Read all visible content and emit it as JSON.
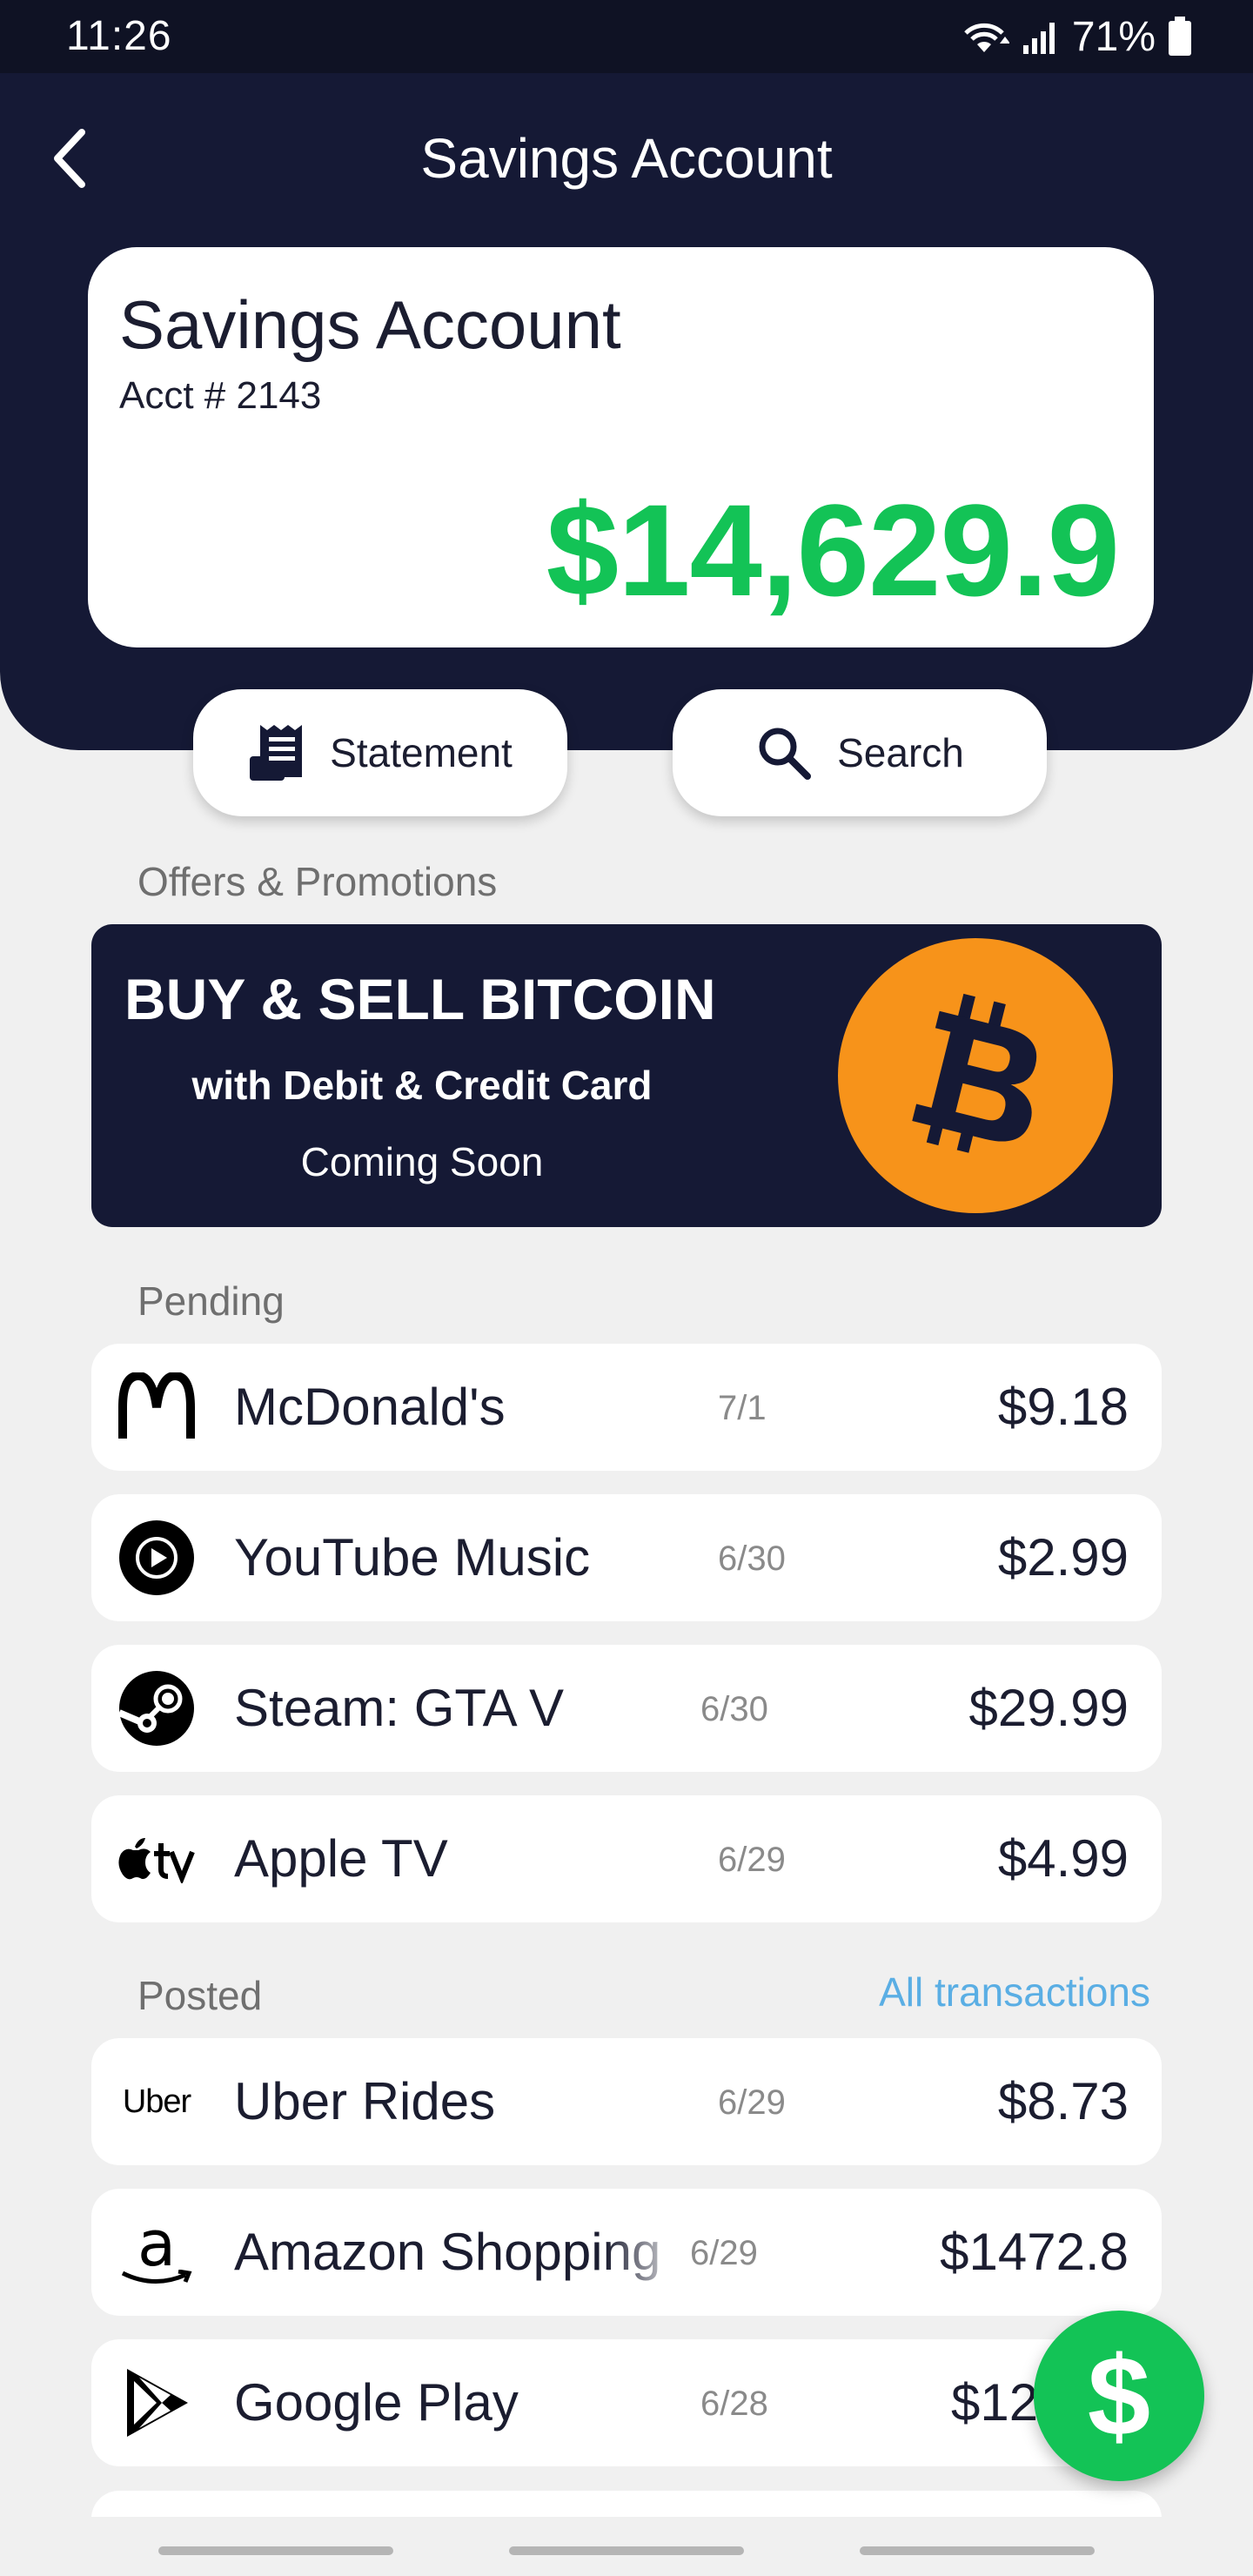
{
  "status_bar": {
    "time": "11:26",
    "battery_pct": "71%"
  },
  "nav": {
    "title": "Savings Account"
  },
  "account": {
    "name": "Savings Account",
    "number": "Acct # 2143",
    "balance": "$14,629.9"
  },
  "actions": {
    "statement_label": "Statement",
    "search_label": "Search"
  },
  "offers": {
    "section_label": "Offers & Promotions",
    "title": "BUY & SELL BITCOIN",
    "subtitle": "with Debit & Credit Card",
    "note": "Coming Soon"
  },
  "pending": {
    "section_label": "Pending",
    "items": [
      {
        "name": "McDonald's",
        "date": "7/1",
        "amount": "$9.18",
        "icon": "mcdonalds-icon"
      },
      {
        "name": "YouTube Music",
        "date": "6/30",
        "amount": "$2.99",
        "icon": "youtube-music-icon"
      },
      {
        "name": "Steam: GTA V",
        "date": "6/30",
        "amount": "$29.99",
        "icon": "steam-icon"
      },
      {
        "name": "Apple TV",
        "date": "6/29",
        "amount": "$4.99",
        "icon": "apple-tv-icon"
      }
    ]
  },
  "posted": {
    "section_label": "Posted",
    "all_link": "All transactions",
    "items": [
      {
        "name": "Uber Rides",
        "date": "6/29",
        "amount": "$8.73",
        "icon": "uber-icon",
        "logo_text": "Uber"
      },
      {
        "name": "Amazon Shopping",
        "date": "6/29",
        "amount": "$1472.8",
        "icon": "amazon-icon",
        "logo_text": "a"
      },
      {
        "name": "Google Play",
        "date": "6/28",
        "amount": "$12",
        "icon": "google-play-icon"
      }
    ]
  },
  "fab": {
    "symbol": "$"
  },
  "colors": {
    "navy": "#151935",
    "green": "#13c356",
    "link_blue": "#5aaee4",
    "bitcoin_orange": "#f7931a"
  }
}
